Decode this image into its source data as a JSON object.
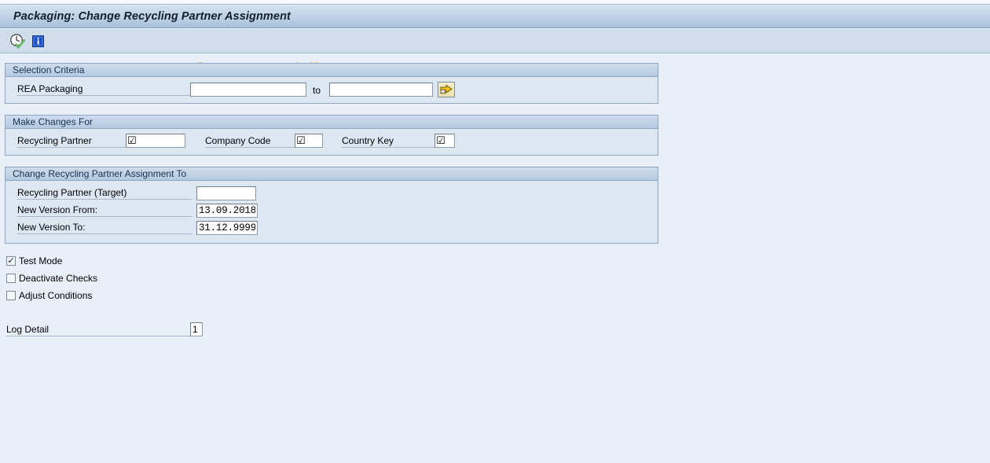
{
  "window": {
    "title": "Packaging: Change Recycling Partner Assignment"
  },
  "toolbar": {
    "buttons": [
      {
        "name": "execute-button",
        "icon": "clock-check-icon",
        "tooltip": "Execute (F8)"
      },
      {
        "name": "info-button",
        "icon": "info-blue-icon",
        "tooltip": "Information"
      }
    ]
  },
  "watermark": {
    "text": "© www.tutorialkart.com",
    "color": "#edc49a"
  },
  "selection_criteria": {
    "header": "Selection Criteria",
    "rea_packaging": {
      "label": "REA Packaging",
      "from_value": "",
      "to_label": "to",
      "to_value": "",
      "multi_select_icon": "multiple-selection-arrow-icon"
    }
  },
  "make_changes_for": {
    "header": "Make Changes For",
    "fields": [
      {
        "label": "Recycling Partner",
        "value": "☑"
      },
      {
        "label": "Company Code",
        "value": "☑"
      },
      {
        "label": "Country Key",
        "value": "☑"
      }
    ]
  },
  "change_assignment_to": {
    "header": "Change Recycling Partner Assignment To",
    "recycling_partner_target": {
      "label": "Recycling Partner (Target)",
      "value": ""
    },
    "new_version_from": {
      "label": "New Version From:",
      "value": "13.09.2018"
    },
    "new_version_to": {
      "label": "New Version To:",
      "value": "31.12.9999"
    }
  },
  "options": [
    {
      "label": "Test Mode",
      "checked": true,
      "tick": "✓"
    },
    {
      "label": "Deactivate Checks",
      "checked": false,
      "tick": ""
    },
    {
      "label": "Adjust Conditions",
      "checked": false,
      "tick": ""
    }
  ],
  "log_detail": {
    "label": "Log Detail",
    "value": "1"
  },
  "colors": {
    "page_background": "#e9eff7",
    "title_bar_gradient_top": "#d3e0ee",
    "title_bar_gradient_bottom": "#9ab4d4",
    "toolbar_background": "#cfdcea",
    "panel_background": "#dde7f2",
    "panel_border": "#8ba7c6",
    "watermark": "#edc49a"
  }
}
